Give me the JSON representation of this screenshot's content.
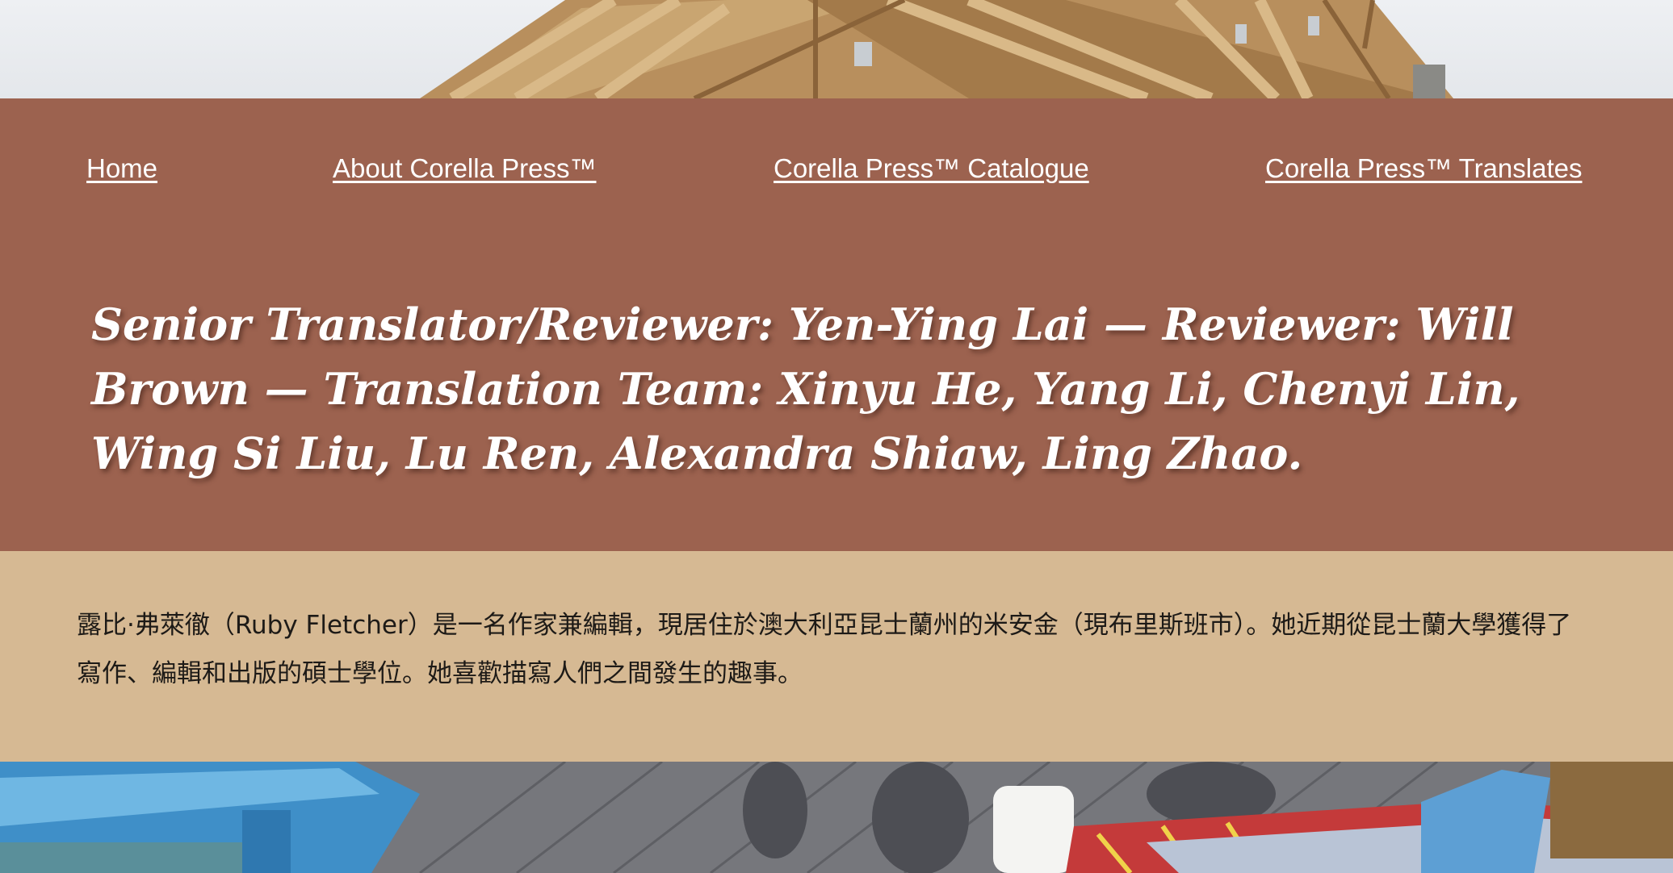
{
  "nav": {
    "items": [
      {
        "label": "Home"
      },
      {
        "label": "About Corella Press™"
      },
      {
        "label": "Corella Press™ Catalogue"
      },
      {
        "label": "Corella Press™ Translates"
      }
    ]
  },
  "credits": {
    "text": "Senior Translator/Reviewer: Yen-Ying Lai — Reviewer: Will Brown — Translation Team: Xinyu He, Yang Li, Chenyi Lin, Wing Si Liu, Lu Ren, Alexandra Shiaw, Ling Zhao."
  },
  "bio": {
    "text": "露比·弗萊徹（Ruby Fletcher）是一名作家兼編輯，現居住於澳大利亞昆士蘭州的米安金（現布里斯班市）。她近期從昆士蘭大學獲得了寫作、編輯和出版的碩士學位。她喜歡描寫人們之間發生的趣事。"
  },
  "colors": {
    "header_band": "#9c624f",
    "bio_band": "#d6b993",
    "nav_text": "#ffffff",
    "bio_text": "#1d1a17"
  }
}
